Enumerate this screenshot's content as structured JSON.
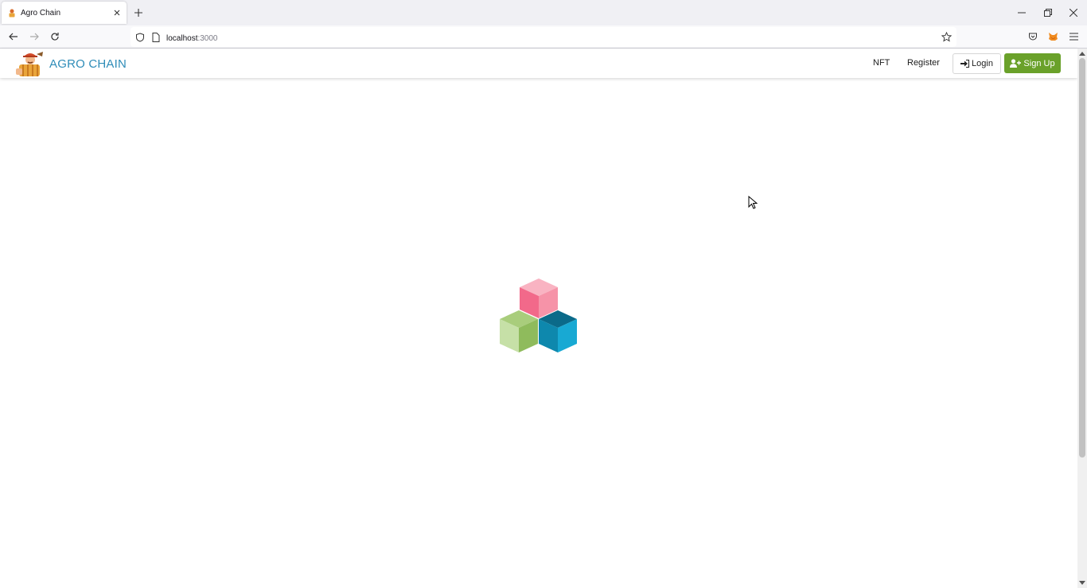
{
  "browser": {
    "tab_title": "Agro Chain",
    "url_host": "localhost",
    "url_port": ":3000"
  },
  "app": {
    "brand_name": "AGRO CHAIN",
    "nav": {
      "nft": "NFT",
      "register": "Register",
      "login": "Login",
      "signup": "Sign Up"
    }
  },
  "colors": {
    "brand_text": "#2e8cb8",
    "signup_button": "#6aa12a",
    "cube_pink": "#f67a93",
    "cube_green": "#9dc36e",
    "cube_blue": "#0f8cb0"
  },
  "icons": [
    "farmer-logo",
    "sign-in-icon",
    "user-plus-icon",
    "shield-icon",
    "page-icon",
    "star-icon",
    "pocket-icon",
    "metamask-fox-icon",
    "menu-icon"
  ]
}
